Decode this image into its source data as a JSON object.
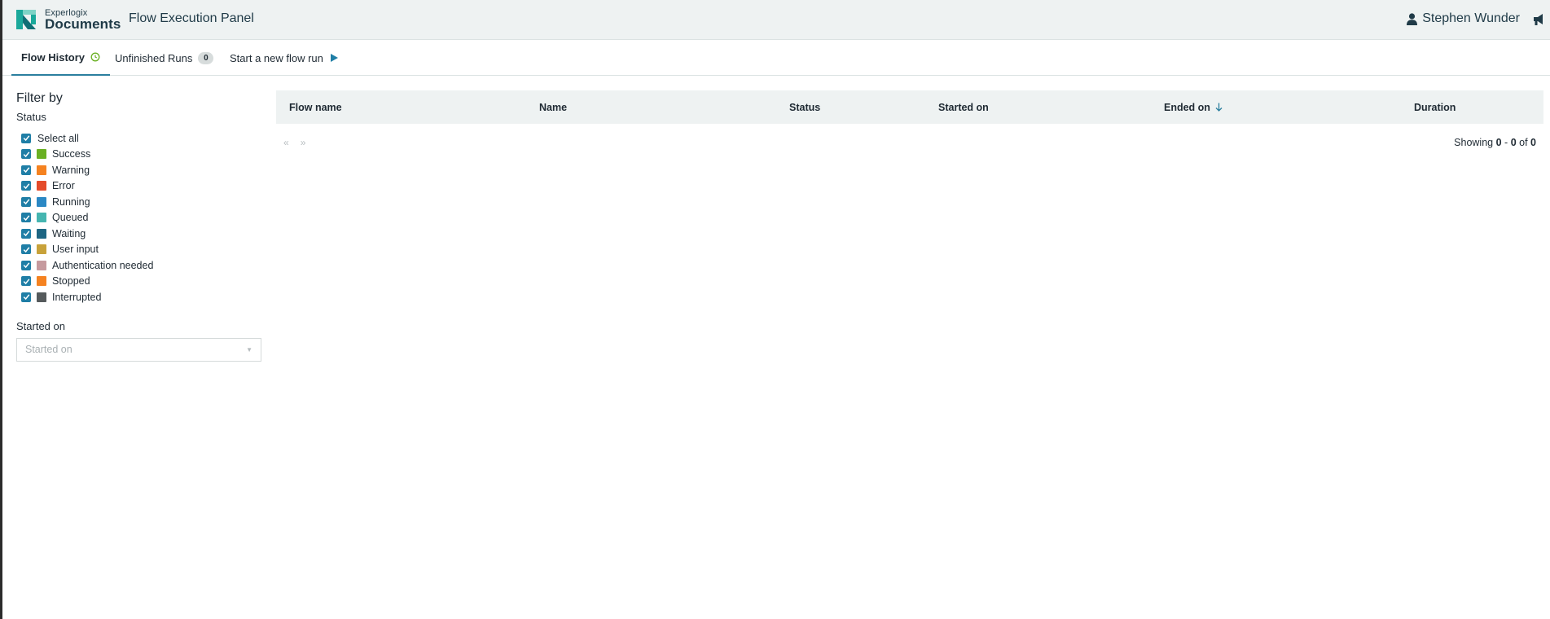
{
  "header": {
    "brand_small": "Experlogix",
    "brand_big": "Documents",
    "app_title": "Flow Execution Panel",
    "user_name": "Stephen Wunder"
  },
  "tabs": [
    {
      "label": "Flow History",
      "active": true
    },
    {
      "label": "Unfinished Runs",
      "badge": "0"
    },
    {
      "label": "Start a new flow run"
    }
  ],
  "filter": {
    "title": "Filter by",
    "status_label": "Status",
    "statuses": [
      {
        "label": "Select all",
        "checked": true
      },
      {
        "label": "Success",
        "color": "#6ab023",
        "checked": true
      },
      {
        "label": "Warning",
        "color": "#f58220",
        "checked": true
      },
      {
        "label": "Error",
        "color": "#e44b2a",
        "checked": true
      },
      {
        "label": "Running",
        "color": "#2b88c4",
        "checked": true
      },
      {
        "label": "Queued",
        "color": "#45b5b0",
        "checked": true
      },
      {
        "label": "Waiting",
        "color": "#1d6683",
        "checked": true
      },
      {
        "label": "User input",
        "color": "#c8a23a",
        "checked": true
      },
      {
        "label": "Authentication needed",
        "color": "#c69a9e",
        "checked": true
      },
      {
        "label": "Stopped",
        "color": "#f58220",
        "checked": true
      },
      {
        "label": "Interrupted",
        "color": "#555a5c",
        "checked": true
      }
    ],
    "started_label": "Started on",
    "started_placeholder": "Started on"
  },
  "table": {
    "columns": [
      "Flow name",
      "Name",
      "Status",
      "Started on",
      "Ended on",
      "Duration"
    ],
    "sort_column": "Ended on",
    "rows": []
  },
  "pagination": {
    "prev": "«",
    "next": "»",
    "showing_prefix": "Showing",
    "from": "0",
    "separator": "-",
    "to": "0",
    "of_label": "of",
    "total": "0"
  },
  "colors": {
    "accent": "#1f7ea6",
    "tab_underline": "#2b7f9e",
    "header_bg": "#eef2f2",
    "play_icon": "#1f7ea6",
    "history_icon": "#6ab023"
  }
}
